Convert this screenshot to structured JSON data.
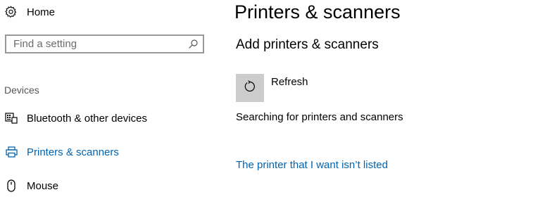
{
  "colors": {
    "accent": "#0063b1",
    "refresh_button_bg": "#cccccc",
    "section_header": "#555555",
    "search_border": "#999999"
  },
  "sidebar": {
    "home": {
      "label": "Home",
      "icon": "gear-icon"
    },
    "search": {
      "placeholder": "Find a setting",
      "value": "",
      "icon": "search-icon"
    },
    "section_header": "Devices",
    "items": [
      {
        "label": "Bluetooth & other devices",
        "icon": "bluetooth-devices-icon",
        "selected": false
      },
      {
        "label": "Printers & scanners",
        "icon": "printer-icon",
        "selected": true
      },
      {
        "label": "Mouse",
        "icon": "mouse-icon",
        "selected": false
      }
    ]
  },
  "main": {
    "title": "Printers & scanners",
    "subtitle": "Add printers & scanners",
    "refresh": {
      "label": "Refresh",
      "icon": "refresh-icon"
    },
    "status": "Searching for printers and scanners",
    "link": "The printer that I want isn’t listed"
  }
}
